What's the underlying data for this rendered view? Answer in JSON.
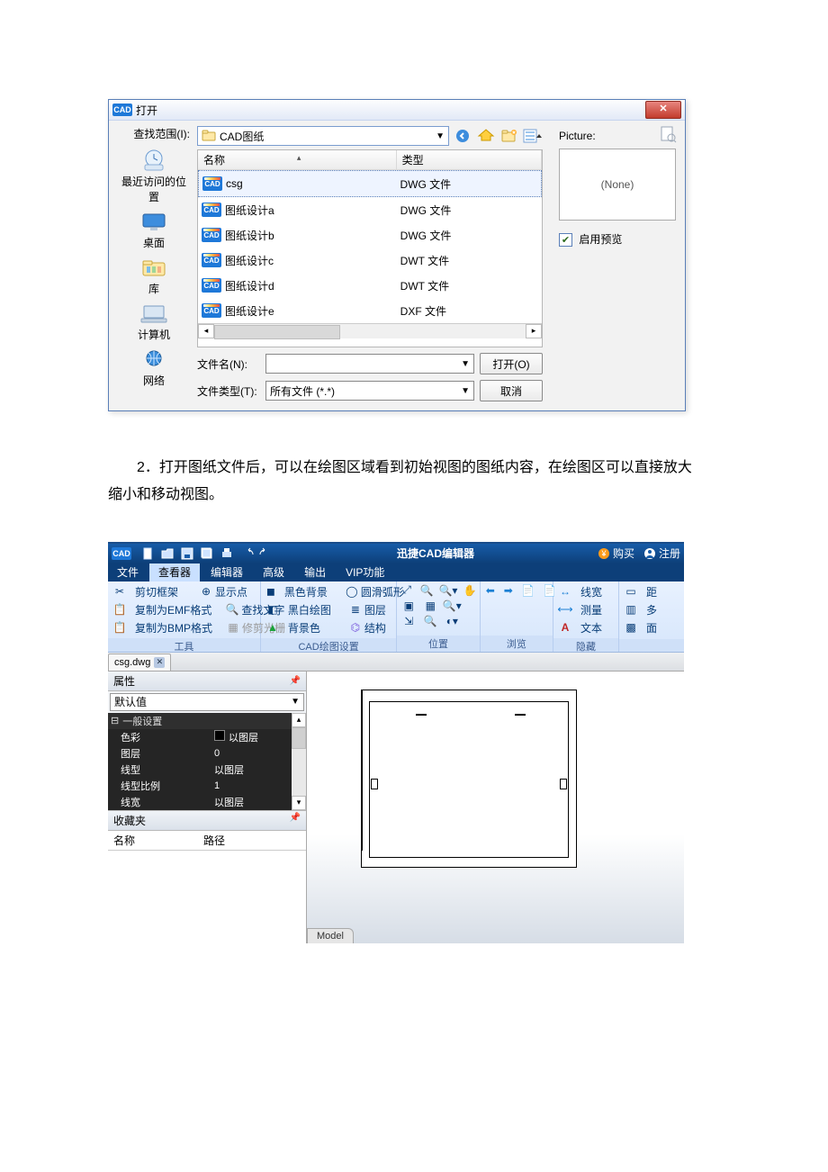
{
  "open_dialog": {
    "title": "打开",
    "lookin_label": "查找范围(I):",
    "folder": "CAD图纸",
    "cols": {
      "name": "名称",
      "type": "类型"
    },
    "files": [
      {
        "name": "csg",
        "type": "DWG 文件",
        "selected": true
      },
      {
        "name": "图纸设计a",
        "type": "DWG 文件",
        "selected": false
      },
      {
        "name": "图纸设计b",
        "type": "DWG 文件",
        "selected": false
      },
      {
        "name": "图纸设计c",
        "type": "DWT 文件",
        "selected": false
      },
      {
        "name": "图纸设计d",
        "type": "DWT 文件",
        "selected": false
      },
      {
        "name": "图纸设计e",
        "type": "DXF 文件",
        "selected": false
      }
    ],
    "filename_label": "文件名(N):",
    "filename_value": "",
    "filetype_label": "文件类型(T):",
    "filetype_value": "所有文件 (*.*)",
    "open_btn": "打开(O)",
    "cancel_btn": "取消",
    "picture_label": "Picture:",
    "preview_none": "(None)",
    "enable_preview": "启用预览",
    "nav": {
      "recent": "最近访问的位置",
      "desktop": "桌面",
      "library": "库",
      "computer": "计算机",
      "network": "网络"
    }
  },
  "paragraph": "2．打开图纸文件后，可以在绘图区域看到初始视图的图纸内容，在绘图区可以直接放大缩小和移动视图。",
  "editor": {
    "app_title": "迅捷CAD编辑器",
    "buy": "购买",
    "register": "注册",
    "menus": [
      "文件",
      "查看器",
      "编辑器",
      "高级",
      "输出",
      "VIP功能"
    ],
    "active_menu": 1,
    "groups": {
      "tools": {
        "items": [
          "剪切框架",
          "复制为EMF格式",
          "复制为BMP格式",
          "显示点",
          "查找文字",
          "修剪光栅"
        ],
        "name": "工具"
      },
      "cad": {
        "items": [
          "黑色背景",
          "黑白绘图",
          "背景色",
          "圆滑弧形",
          "图层",
          "结构"
        ],
        "name": "CAD绘图设置"
      },
      "pos": {
        "name": "位置"
      },
      "browse": {
        "name": "浏览"
      },
      "hide": {
        "items": [
          "线宽",
          "测量",
          "文本"
        ],
        "name": "隐藏"
      },
      "extra": {
        "items": [
          "距",
          "多",
          "面"
        ]
      }
    },
    "doc_tab": "csg.dwg",
    "properties": {
      "title": "属性",
      "default": "默认值",
      "section": "一般设置",
      "rows": [
        {
          "k": "色彩",
          "v": "以图层",
          "swatch": true
        },
        {
          "k": "图层",
          "v": "0"
        },
        {
          "k": "线型",
          "v": "以图层"
        },
        {
          "k": "线型比例",
          "v": "1"
        },
        {
          "k": "线宽",
          "v": "以图层"
        }
      ]
    },
    "favorites": {
      "title": "收藏夹",
      "cols": {
        "name": "名称",
        "path": "路径"
      }
    },
    "model_tab": "Model"
  },
  "icon_text": {
    "cad": "CAD"
  }
}
